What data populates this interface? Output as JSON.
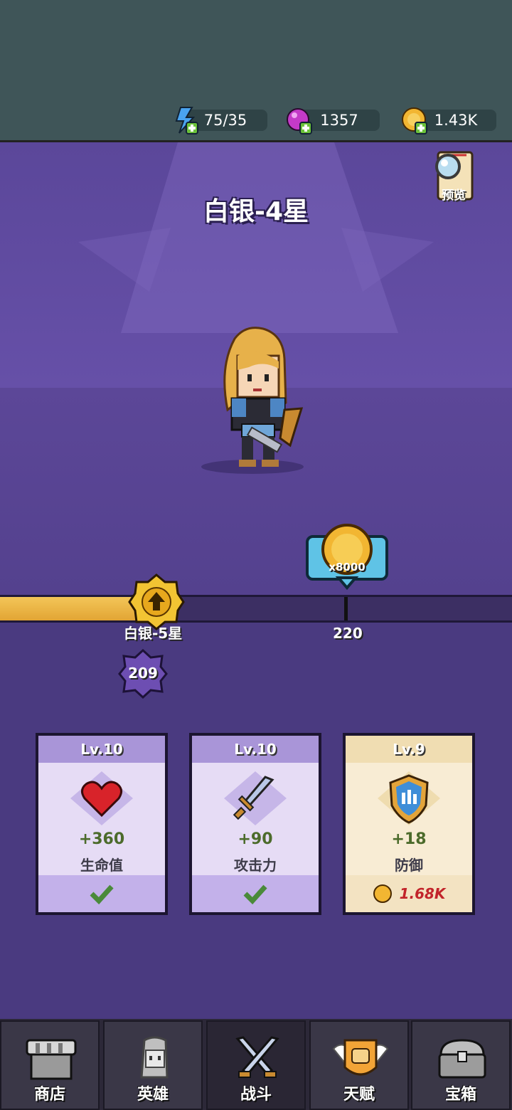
{
  "resources": [
    {
      "icon": "energy-icon",
      "value": "75/35"
    },
    {
      "icon": "gem-icon",
      "value": "1357"
    },
    {
      "icon": "coin-icon",
      "value": "1.43K"
    }
  ],
  "stage": {
    "rank_title": "白银-4星",
    "preview_label": "预览"
  },
  "progress": {
    "fill_fraction": 0.3,
    "next_rank_label": "白银-5星",
    "current_points": "209",
    "reward_amount": "x8000",
    "reward_points": "220"
  },
  "cards": [
    {
      "level": "Lv.10",
      "value": "+360",
      "name": "生命值",
      "icon": "heart-icon",
      "status": "maxed"
    },
    {
      "level": "Lv.10",
      "value": "+90",
      "name": "攻击力",
      "icon": "sword-icon",
      "status": "maxed"
    },
    {
      "level": "Lv.9",
      "value": "+18",
      "name": "防御",
      "icon": "shield-icon",
      "cost": "1.68K"
    }
  ],
  "nav": [
    {
      "label": "商店",
      "icon": "shop-icon"
    },
    {
      "label": "英雄",
      "icon": "hero-icon"
    },
    {
      "label": "战斗",
      "icon": "crossed-swords-icon"
    },
    {
      "label": "天赋",
      "icon": "talent-fist-icon"
    },
    {
      "label": "宝箱",
      "icon": "chest-icon"
    }
  ],
  "colors": {
    "accent": "#f0b840",
    "panel": "#4a3a80",
    "topbar": "#3f5558"
  }
}
